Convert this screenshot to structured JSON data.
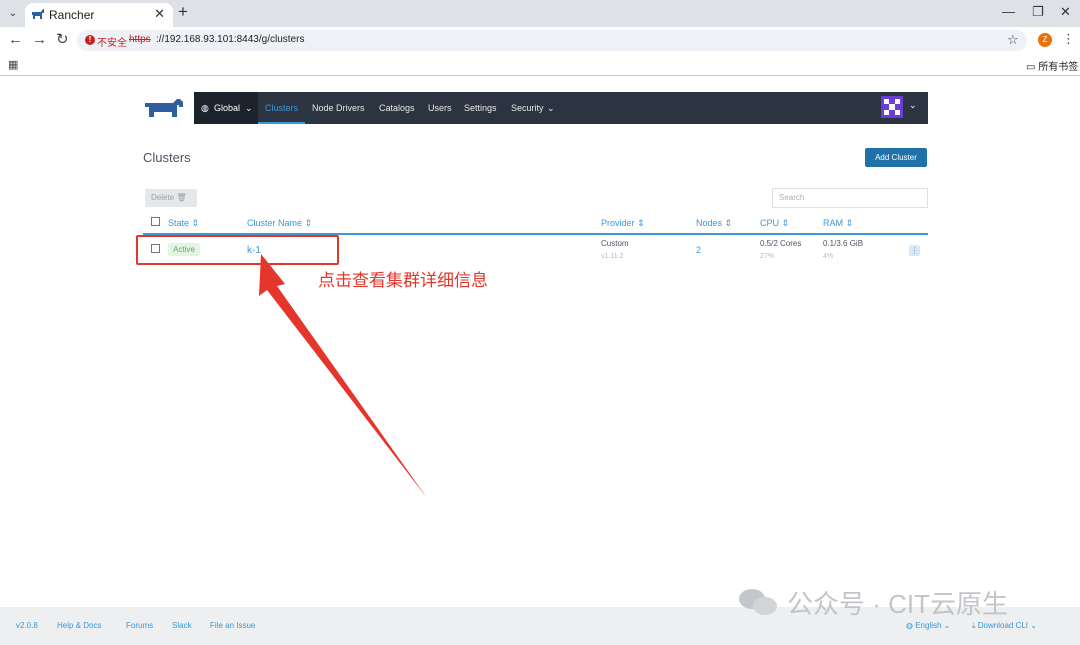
{
  "browser": {
    "tab_title": "Rancher",
    "security_label": "不安全",
    "url_scheme": "https",
    "url_rest": "://192.168.93.101:8443/g/clusters",
    "profile_initial": "Z",
    "bookmark_folder": "所有书签"
  },
  "nav": {
    "global": "Global",
    "items": [
      "Clusters",
      "Node Drivers",
      "Catalogs",
      "Users",
      "Settings",
      "Security"
    ],
    "active": "Clusters"
  },
  "page": {
    "title": "Clusters",
    "add_button": "Add Cluster",
    "delete_button": "Delete",
    "search_placeholder": "Search"
  },
  "table": {
    "headers": [
      "State",
      "Cluster Name",
      "Provider",
      "Nodes",
      "CPU",
      "RAM"
    ],
    "rows": [
      {
        "state": "Active",
        "name": "k-1",
        "provider": "Custom",
        "provider_version": "v1.11.2",
        "nodes": "2",
        "cpu": "0.5/2 Cores",
        "cpu_pct": "27%",
        "ram": "0.1/3.6 GiB",
        "ram_pct": "4%"
      }
    ]
  },
  "annotation": "点击查看集群详细信息",
  "footer": {
    "version": "v2.0.8",
    "links": [
      "Help & Docs",
      "Forums",
      "Slack",
      "File an Issue"
    ],
    "language": "English",
    "download": "Download CLI"
  },
  "watermark": "公众号 · CIT云原生",
  "colors": {
    "accent": "#3d98d3",
    "nav_bg": "#2b3440",
    "annotation": "#e5362c",
    "active_badge": "#5ab15a"
  }
}
